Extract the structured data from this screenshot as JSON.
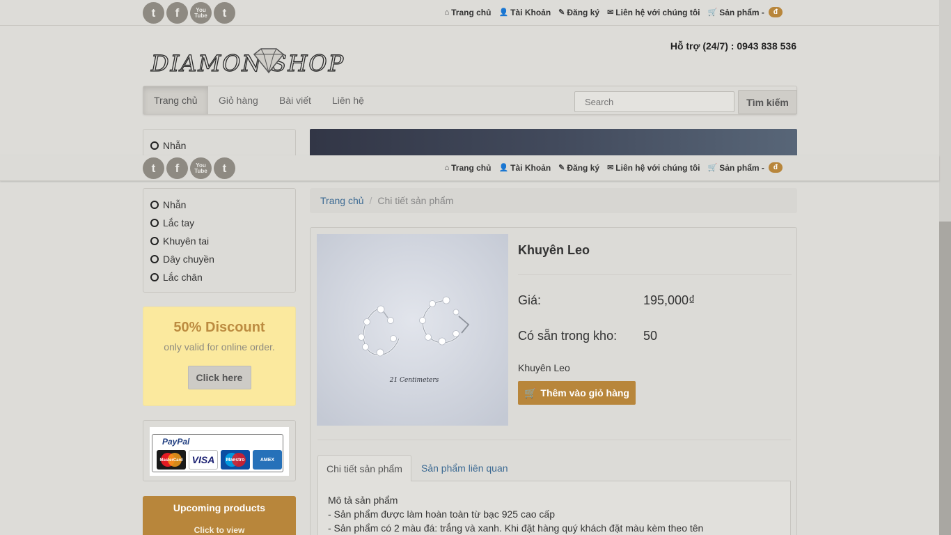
{
  "topbar": {
    "social": [
      "t",
      "f",
      "You Tube",
      "t"
    ],
    "links": [
      {
        "icon": "home-icon",
        "glyph": "⌂",
        "label": "Trang chủ"
      },
      {
        "icon": "user-icon",
        "glyph": "👤",
        "label": "Tài Khoản"
      },
      {
        "icon": "edit-icon",
        "glyph": "✎",
        "label": "Đăng ký"
      },
      {
        "icon": "envelope-icon",
        "glyph": "✉",
        "label": "Liên hệ với chúng tôi"
      },
      {
        "icon": "cart-icon",
        "glyph": "🛒",
        "label": "Sản phẩm -"
      }
    ],
    "cart_badge": "đ"
  },
  "header": {
    "logo_text": "DIAMON SHOP",
    "support": "Hỗ trợ (24/7) : 0943 838 536"
  },
  "nav": {
    "items": [
      "Trang chủ",
      "Giỏ hàng",
      "Bài viết",
      "Liên hệ"
    ],
    "search_placeholder": "Search",
    "search_button": "Tìm kiếm"
  },
  "sidebar": {
    "categories": [
      "Nhẫn",
      "Lắc tay",
      "Khuyên tai",
      "Dây chuyền",
      "Lắc chân"
    ],
    "discount": {
      "title": "50% Discount",
      "subtitle": "only valid for online order.",
      "button": "Click here"
    },
    "payment": {
      "label": "PayPal",
      "cards": [
        "MasterCard",
        "VISA",
        "Maestro",
        "AMEX"
      ]
    },
    "upcoming": {
      "title": "Upcoming products",
      "link": "Click to view"
    }
  },
  "breadcrumb": {
    "home": "Trang chủ",
    "separator": "/",
    "current": "Chi tiết sản phẩm"
  },
  "product": {
    "name": "Khuyên Leo",
    "price_label": "Giá:",
    "price": "195,000₫",
    "stock_label": "Có sẵn trong kho:",
    "stock": "50",
    "short_desc": "Khuyên Leo",
    "add_to_cart": "Thêm vào giỏ hàng",
    "image_caption": "21 Centimeters",
    "tabs": [
      "Chi tiết sản phẩm",
      "Sản phẩm liên quan"
    ],
    "description": [
      "Mô tả sản phẩm",
      "- Sản phẩm được làm hoàn toàn từ bạc 925 cao cấp",
      "- Sản phẩm có 2 màu đá: trắng và xanh. Khi đặt hàng quý khách đặt màu kèm theo tên"
    ]
  },
  "colors": {
    "accent": "#b8863b",
    "link": "#3c6a93",
    "background": "#dddcd8",
    "discount_bg": "#fbe99e"
  }
}
